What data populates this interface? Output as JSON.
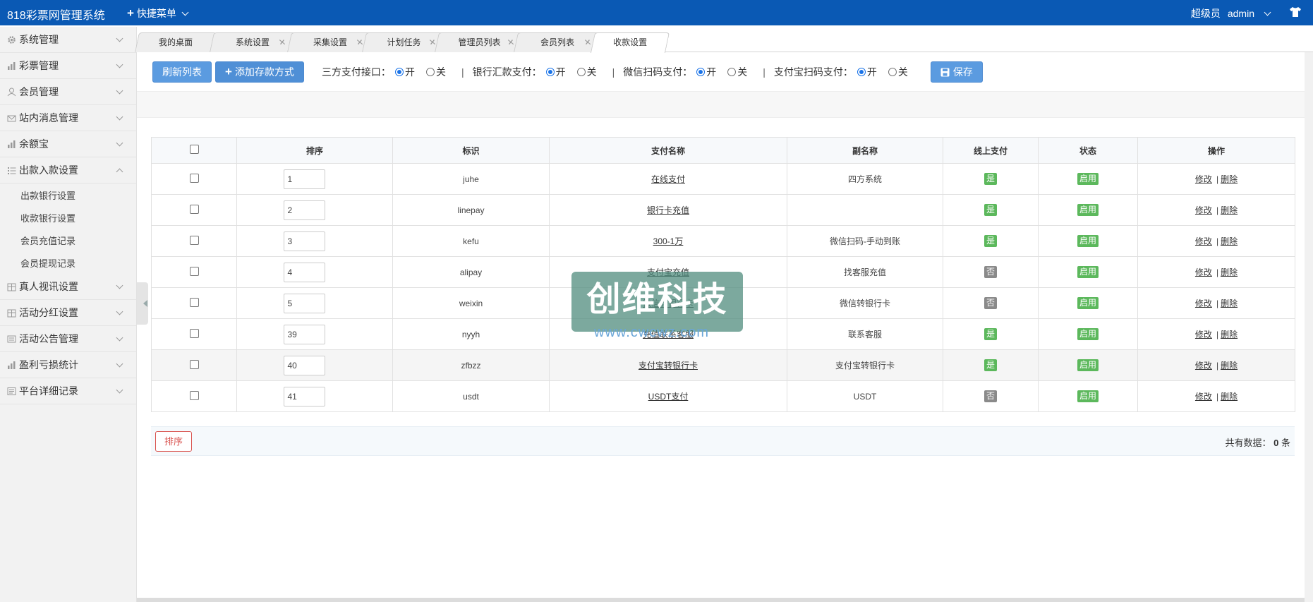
{
  "topbar": {
    "brand": "818彩票网管理系统",
    "quick_menu": "快捷菜单",
    "role": "超级员",
    "username": "admin"
  },
  "sidebar": {
    "items": [
      {
        "label": "系统管理",
        "icon": "gear-icon"
      },
      {
        "label": "彩票管理",
        "icon": "chart-icon"
      },
      {
        "label": "会员管理",
        "icon": "user-icon"
      },
      {
        "label": "站内消息管理",
        "icon": "mail-icon"
      },
      {
        "label": "余额宝",
        "icon": "chart-icon"
      },
      {
        "label": "出款入款设置",
        "icon": "list-icon",
        "expanded": true,
        "children": [
          "出款银行设置",
          "收款银行设置",
          "会员充值记录",
          "会员提现记录"
        ]
      },
      {
        "label": "真人视讯设置",
        "icon": "grid-icon"
      },
      {
        "label": "活动分红设置",
        "icon": "grid-icon"
      },
      {
        "label": "活动公告管理",
        "icon": "notice-icon"
      },
      {
        "label": "盈利亏损统计",
        "icon": "chart-icon"
      },
      {
        "label": "平台详细记录",
        "icon": "record-icon"
      }
    ]
  },
  "tabs": [
    "我的桌面",
    "系统设置",
    "采集设置",
    "计划任务",
    "管理员列表",
    "会员列表",
    "收款设置"
  ],
  "toolbar": {
    "refresh": "刷新列表",
    "add": "添加存款方式",
    "groups": [
      {
        "label": "三方支付接口：",
        "on": "开",
        "off": "关"
      },
      {
        "label": "银行汇款支付：",
        "on": "开",
        "off": "关"
      },
      {
        "label": "微信扫码支付：",
        "on": "开",
        "off": "关"
      },
      {
        "label": "支付宝扫码支付：",
        "on": "开",
        "off": "关"
      }
    ],
    "save": "保存"
  },
  "table": {
    "headers": [
      "排序",
      "标识",
      "支付名称",
      "副名称",
      "线上支付",
      "状态",
      "操作"
    ],
    "rows": [
      {
        "order": "1",
        "id": "juhe",
        "name": "在线支付",
        "sub": "四方系统",
        "online": "是",
        "status": "启用"
      },
      {
        "order": "2",
        "id": "linepay",
        "name": "银行卡充值",
        "sub": "",
        "online": "是",
        "status": "启用"
      },
      {
        "order": "3",
        "id": "kefu",
        "name": "300-1万",
        "sub": "微信扫码-手动到账",
        "online": "是",
        "status": "启用"
      },
      {
        "order": "4",
        "id": "alipay",
        "name": "支付宝充值",
        "sub": "找客服充值",
        "online": "否",
        "status": "启用"
      },
      {
        "order": "5",
        "id": "weixin",
        "name": "微信转银行卡",
        "sub": "微信转银行卡",
        "online": "否",
        "status": "启用"
      },
      {
        "order": "39",
        "id": "nyyh",
        "name": "充值联系客服",
        "sub": "联系客服",
        "online": "是",
        "status": "启用"
      },
      {
        "order": "40",
        "id": "zfbzz",
        "name": "支付宝转银行卡",
        "sub": "支付宝转银行卡",
        "online": "是",
        "status": "启用"
      },
      {
        "order": "41",
        "id": "usdt",
        "name": "USDT支付",
        "sub": "USDT",
        "online": "否",
        "status": "启用"
      }
    ],
    "edit": "修改",
    "del": "删除",
    "divider": "|"
  },
  "footer": {
    "sort": "排序",
    "total_label": "共有数据：",
    "total_count": "0",
    "total_unit": "条"
  },
  "watermark": {
    "title": "创维科技",
    "url": "www.cwcwz.com"
  }
}
